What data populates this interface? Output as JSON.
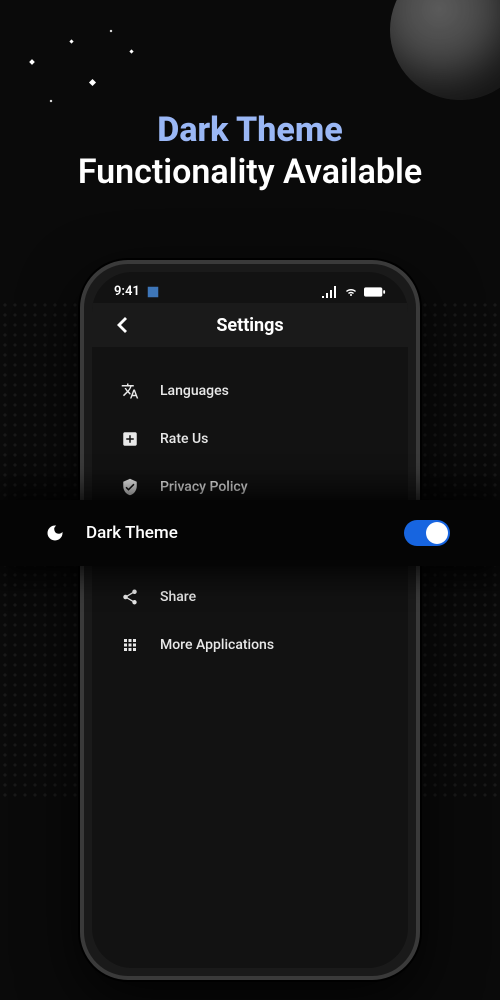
{
  "promo": {
    "line1": "Dark Theme",
    "line2": "Functionality Available"
  },
  "status_bar": {
    "time": "9:41"
  },
  "header": {
    "title": "Settings"
  },
  "settings": {
    "items": [
      {
        "icon": "translate-icon",
        "label": "Languages"
      },
      {
        "icon": "plus-box-icon",
        "label": "Rate Us"
      },
      {
        "icon": "shield-check-icon",
        "label": "Privacy Policy"
      },
      {
        "icon": "moon-icon",
        "label": "Dark Theme",
        "highlighted": true,
        "toggle": true
      },
      {
        "icon": "share-icon",
        "label": "Share"
      },
      {
        "icon": "grid-icon",
        "label": "More Applications"
      }
    ]
  },
  "colors": {
    "accent": "#1765e0",
    "promo_blue": "#9ab7f5"
  }
}
